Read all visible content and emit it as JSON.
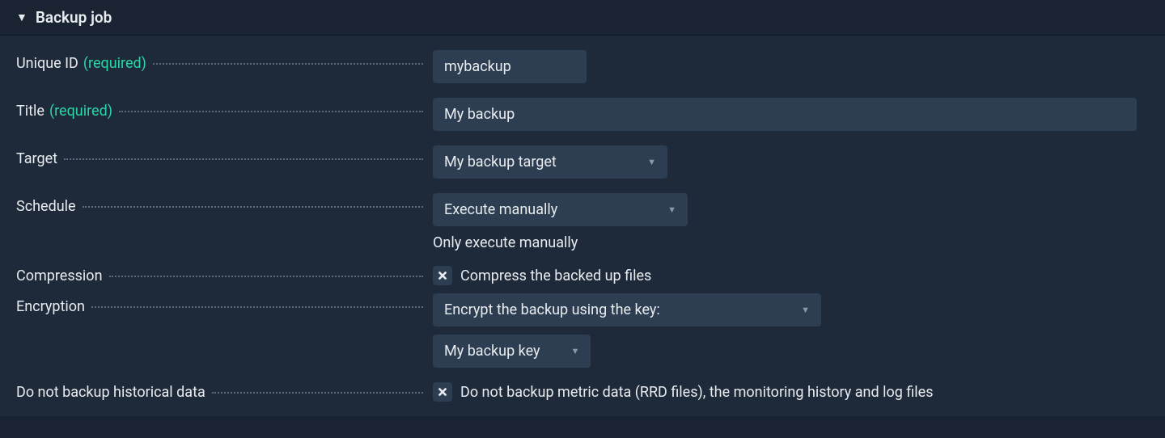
{
  "section": {
    "title": "Backup job"
  },
  "labels": {
    "unique_id": "Unique ID",
    "title": "Title",
    "target": "Target",
    "schedule": "Schedule",
    "compression": "Compression",
    "encryption": "Encryption",
    "historical": "Do not backup historical data",
    "required": "(required)"
  },
  "fields": {
    "unique_id": "mybackup",
    "title": "My backup",
    "target": "My backup target",
    "schedule": "Execute manually",
    "schedule_hint": "Only execute manually",
    "compression_label": "Compress the backed up files",
    "encryption": "Encrypt the backup using the key:",
    "encryption_key": "My backup key",
    "historical_label": "Do not backup metric data (RRD files), the monitoring history and log files"
  }
}
